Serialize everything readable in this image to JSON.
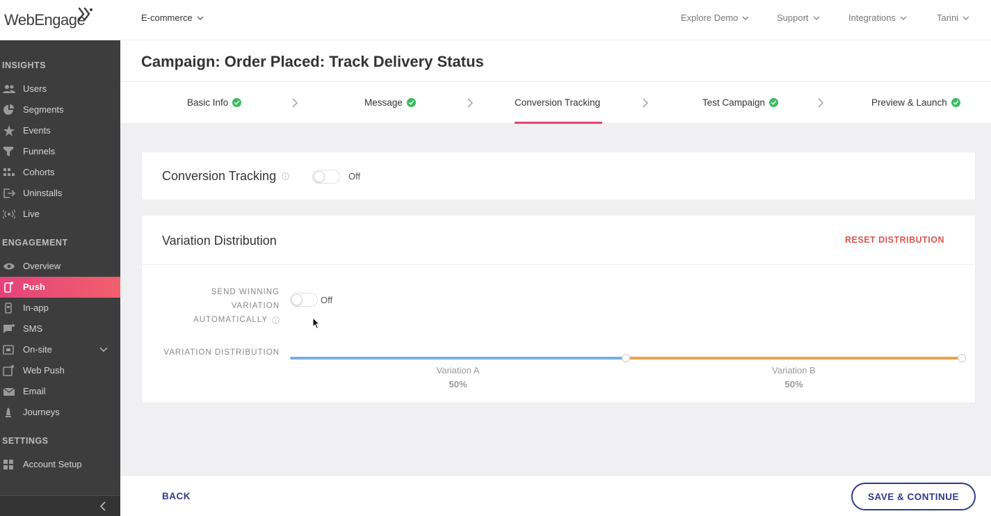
{
  "app": {
    "brand": "WebEngage",
    "workspace": "E-commerce"
  },
  "topnav": [
    {
      "label": "Explore Demo"
    },
    {
      "label": "Support"
    },
    {
      "label": "Integrations"
    },
    {
      "label": "Tarini"
    }
  ],
  "sidebar": {
    "sections": [
      {
        "title": "INSIGHTS",
        "items": [
          {
            "label": "Users",
            "icon": "users-icon"
          },
          {
            "label": "Segments",
            "icon": "pie-icon"
          },
          {
            "label": "Events",
            "icon": "star-icon"
          },
          {
            "label": "Funnels",
            "icon": "funnel-icon"
          },
          {
            "label": "Cohorts",
            "icon": "grid-icon"
          },
          {
            "label": "Uninstalls",
            "icon": "exit-icon"
          },
          {
            "label": "Live",
            "icon": "broadcast-icon"
          }
        ]
      },
      {
        "title": "ENGAGEMENT",
        "items": [
          {
            "label": "Overview",
            "icon": "eye-icon"
          },
          {
            "label": "Push",
            "icon": "push-icon",
            "active": true
          },
          {
            "label": "In-app",
            "icon": "mobile-icon"
          },
          {
            "label": "SMS",
            "icon": "sms-icon"
          },
          {
            "label": "On-site",
            "icon": "window-icon"
          },
          {
            "label": "Web Push",
            "icon": "webpush-icon"
          },
          {
            "label": "Email",
            "icon": "mail-icon"
          },
          {
            "label": "Journeys",
            "icon": "journey-icon"
          }
        ]
      },
      {
        "title": "SETTINGS",
        "items": [
          {
            "label": "Account Setup",
            "icon": "apps-icon"
          }
        ]
      }
    ]
  },
  "page": {
    "title": "Campaign: Order Placed: Track Delivery Status"
  },
  "steps": [
    {
      "label": "Basic Info",
      "done": true
    },
    {
      "label": "Message",
      "done": true
    },
    {
      "label": "Conversion Tracking",
      "done": false,
      "active": true
    },
    {
      "label": "Test Campaign",
      "done": true
    },
    {
      "label": "Preview & Launch",
      "done": true
    }
  ],
  "conversion": {
    "title": "Conversion Tracking",
    "toggle_state": "Off"
  },
  "variation": {
    "title": "Variation Distribution",
    "reset_label": "RESET DISTRIBUTION",
    "send_winning_label_1": "SEND WINNING",
    "send_winning_label_2": "VARIATION",
    "send_winning_label_3": "AUTOMATICALLY",
    "send_winning_state": "Off",
    "distribution_label": "VARIATION DISTRIBUTION",
    "variations": [
      {
        "name": "Variation A",
        "percent": "50%",
        "share": 0.5
      },
      {
        "name": "Variation B",
        "percent": "50%",
        "share": 0.5
      }
    ]
  },
  "footer": {
    "back_label": "BACK",
    "save_label": "SAVE & CONTINUE"
  },
  "colors": {
    "accent": "#e5427a",
    "primary": "#2e3a8c",
    "success": "#3dbb61",
    "variation_a": "#77aee5",
    "variation_b": "#f0a14f",
    "reset": "#e2544f"
  }
}
